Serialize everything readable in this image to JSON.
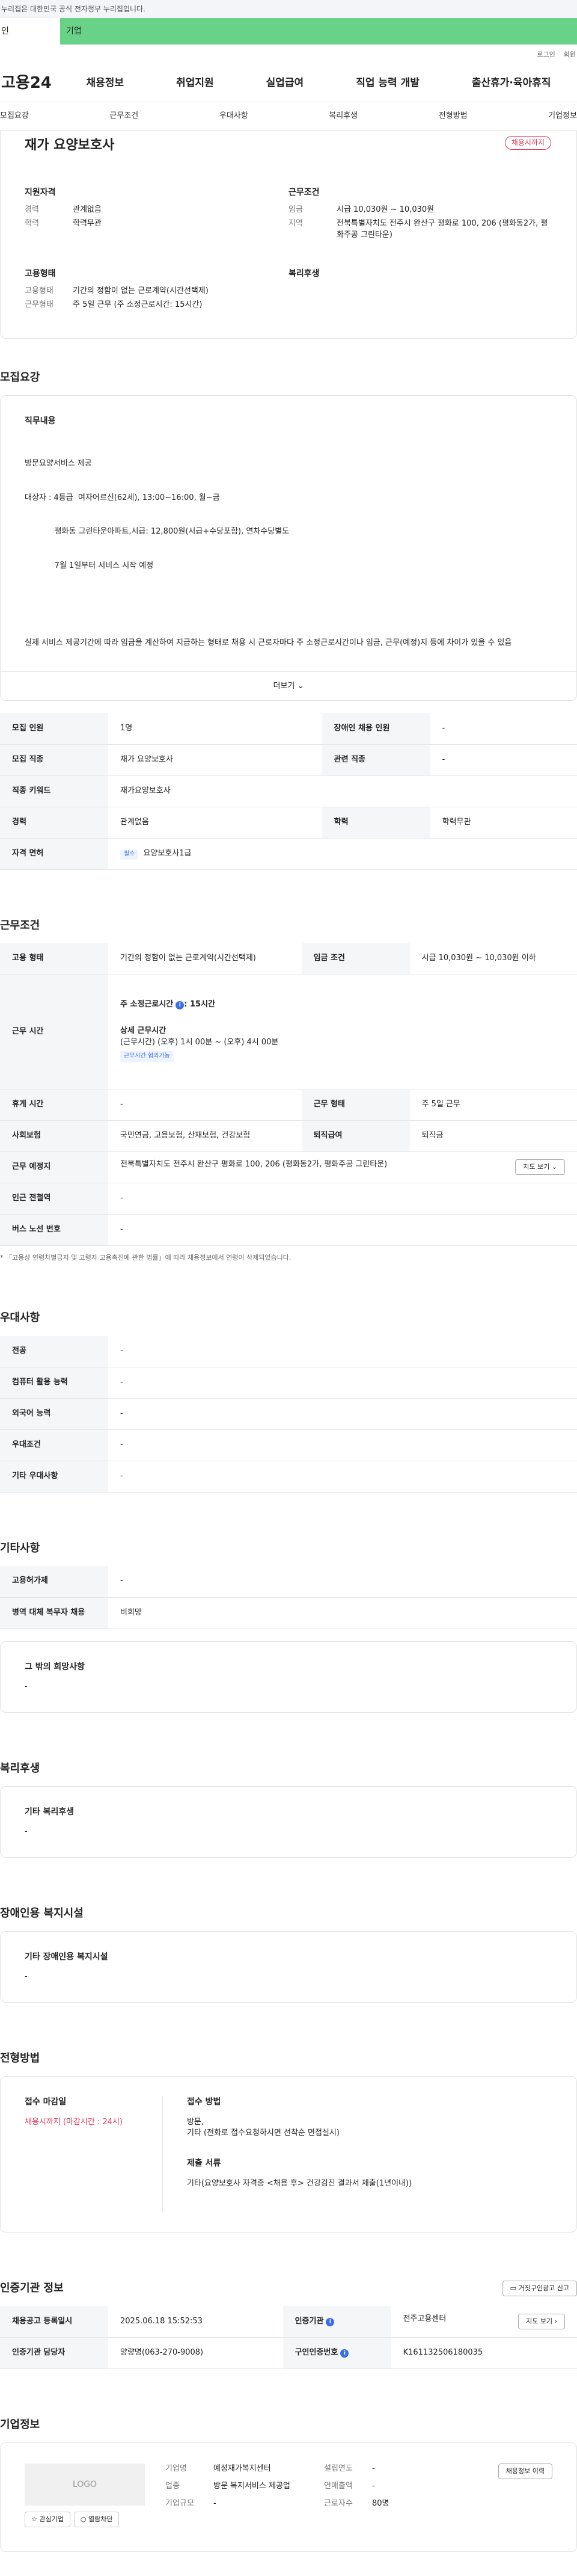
{
  "govbar": "누리집은 대한민국 공식 전자정부 누리집입니다.",
  "usertabs": [
    "인",
    "기업"
  ],
  "toplinks": [
    "로그인",
    "회원"
  ],
  "logo": "고용24",
  "gnb": [
    "채용정보",
    "취업지원",
    "실업급여",
    "직업 능력 개발",
    "출산휴가·육아휴직"
  ],
  "lnb": [
    "모집요강",
    "근무조건",
    "우대사항",
    "복리후생",
    "전형방법",
    "기업정보"
  ],
  "hero": {
    "title": "재가 요양보호사",
    "badge": "채용시까지",
    "qual_title": "지원자격",
    "qual": [
      [
        "경력",
        "관계없음"
      ],
      [
        "학력",
        "학력무관"
      ]
    ],
    "work_title": "근무조건",
    "work": [
      [
        "임금",
        "시급 10,030원 ~ 10,030원"
      ],
      [
        "지역",
        "전북특별자치도 전주시 완산구 평화로 100, 206 (평화동2가, 평화주공 그린타운)"
      ]
    ],
    "emp_title": "고용형태",
    "emp": [
      [
        "고용형태",
        "기간의 정함이 없는 근로계약(시간선택제)"
      ],
      [
        "근무형태",
        "주 5일 근무 (주 소정근로시간: 15시간)"
      ]
    ],
    "welfare_title": "복리후생"
  },
  "recruit": {
    "title": "모집요강",
    "job_title": "직무내용",
    "job_lines": [
      "방문요양서비스 제공",
      "대상자 : 4등급  여자어르신(62세), 13:00~16:00, 월~금",
      "            평화동 그린타운아파트,시급: 12,800원(시급+수당포함), 연차수당별도",
      "            7월 1일부터 서비스 시작 예정",
      "",
      "실제 서비스 제공기간에 따라 임금을 계산하여 지급하는 형태로 채용 시 근로자마다 주 소정근로시간이나 임금, 근무(예정)지 등에 차이가 있을 수 있음"
    ],
    "more": "더보기",
    "rows": [
      [
        "모집 인원",
        "1명",
        "장애인 채용 인원",
        "-"
      ],
      [
        "모집 직종",
        "재가 요양보호사",
        "관련 직종",
        "-"
      ],
      [
        "직종 키워드",
        "재가요양보호사"
      ],
      [
        "경력",
        "관계없음",
        "학력",
        "학력무관"
      ],
      [
        "자격 면허",
        "필수",
        "요양보호사1급"
      ]
    ]
  },
  "cond": {
    "title": "근무조건",
    "emp_type": [
      "고용 형태",
      "기간의 정함이 없는 근로계약(시간선택제)",
      "임금 조건",
      "시급 10,030원 ~ 10,030원 이하"
    ],
    "hours_label": "근무 시간",
    "hours_week": "주 소정근로시간",
    "hours_week_val": ": 15시간",
    "hours_detail_title": "상세 근무시간",
    "hours_detail": "(근무시간) (오후) 1시 00분 ~ (오후) 4시 00분",
    "hours_tag": "근무시간 협의가능",
    "rows": [
      [
        "휴게 시간",
        "-",
        "근무 형태",
        "주 5일 근무"
      ],
      [
        "사회보험",
        "국민연금, 고용보험, 산재보험, 건강보험",
        "퇴직급여",
        "퇴직금"
      ]
    ],
    "place": [
      "근무 예정지",
      "전북특별자치도 전주시 완산구 평화로 100, 206 (평화동2가, 평화주공 그린타운)",
      "지도 보기"
    ],
    "rows2": [
      [
        "인근 전철역",
        "-"
      ],
      [
        "버스 노선 번호",
        "-"
      ]
    ],
    "note": "* 「고용상 연령차별금지 및 고령자 고용촉진에 관한 법률」에 따라 채용정보에서 연령이 삭제되었습니다."
  },
  "pref": {
    "title": "우대사항",
    "rows": [
      [
        "전공",
        "-"
      ],
      [
        "컴퓨터 활용 능력",
        "-"
      ],
      [
        "외국어 능력",
        "-"
      ],
      [
        "우대조건",
        "-"
      ],
      [
        "기타 우대사항",
        "-"
      ]
    ]
  },
  "etc": {
    "title": "기타사항",
    "rows": [
      [
        "고용허가제",
        "-"
      ],
      [
        "병역 대체 복무자 채용",
        "비희망"
      ]
    ],
    "other_title": "그 밖의 희망사항",
    "other_val": "-"
  },
  "welfare": {
    "title": "복리후생",
    "sub": "기타 복리후생",
    "val": "-"
  },
  "disab": {
    "title": "장애인용 복지시설",
    "sub": "기타 장애인용 복지시설",
    "val": "-"
  },
  "select": {
    "title": "전형방법",
    "deadline_title": "접수 마감일",
    "deadline": "채용시까지 (마감시간 : 24시)",
    "method_title": "접수 방법",
    "method": "방문,",
    "method2": "기타 (전화로 접수요청하시면 선착순 면접실시)",
    "docs_title": "제출 서류",
    "docs": "기타(요양보호사 자격증 <채용 후> 건강검진 결과서 제출(1년이내))"
  },
  "cert": {
    "title": "인증기관 정보",
    "report": "거짓구인광고 신고",
    "reg_date": [
      "채용공고 등록일시",
      "2025.06.18 15:52:53",
      "인증기관",
      "전주고용센터",
      "지도 보기"
    ],
    "manager": [
      "인증기관 담당자",
      "양량명(063-270-9008)",
      "구인인증번호",
      "K161132506180035"
    ]
  },
  "company": {
    "title": "기업정보",
    "logo": "LOGO",
    "btn1": "관심기업",
    "btn2": "열람차단",
    "rows": [
      [
        "기업명",
        "예성재가복지센터"
      ],
      [
        "업종",
        "방문 복지서비스 제공업"
      ],
      [
        "기업규모",
        "-"
      ]
    ],
    "rows2": [
      [
        "설립연도",
        "-"
      ],
      [
        "연매출액",
        "-"
      ],
      [
        "근로자수",
        "80명"
      ]
    ],
    "recruit_btn": "채용정보 이력"
  }
}
